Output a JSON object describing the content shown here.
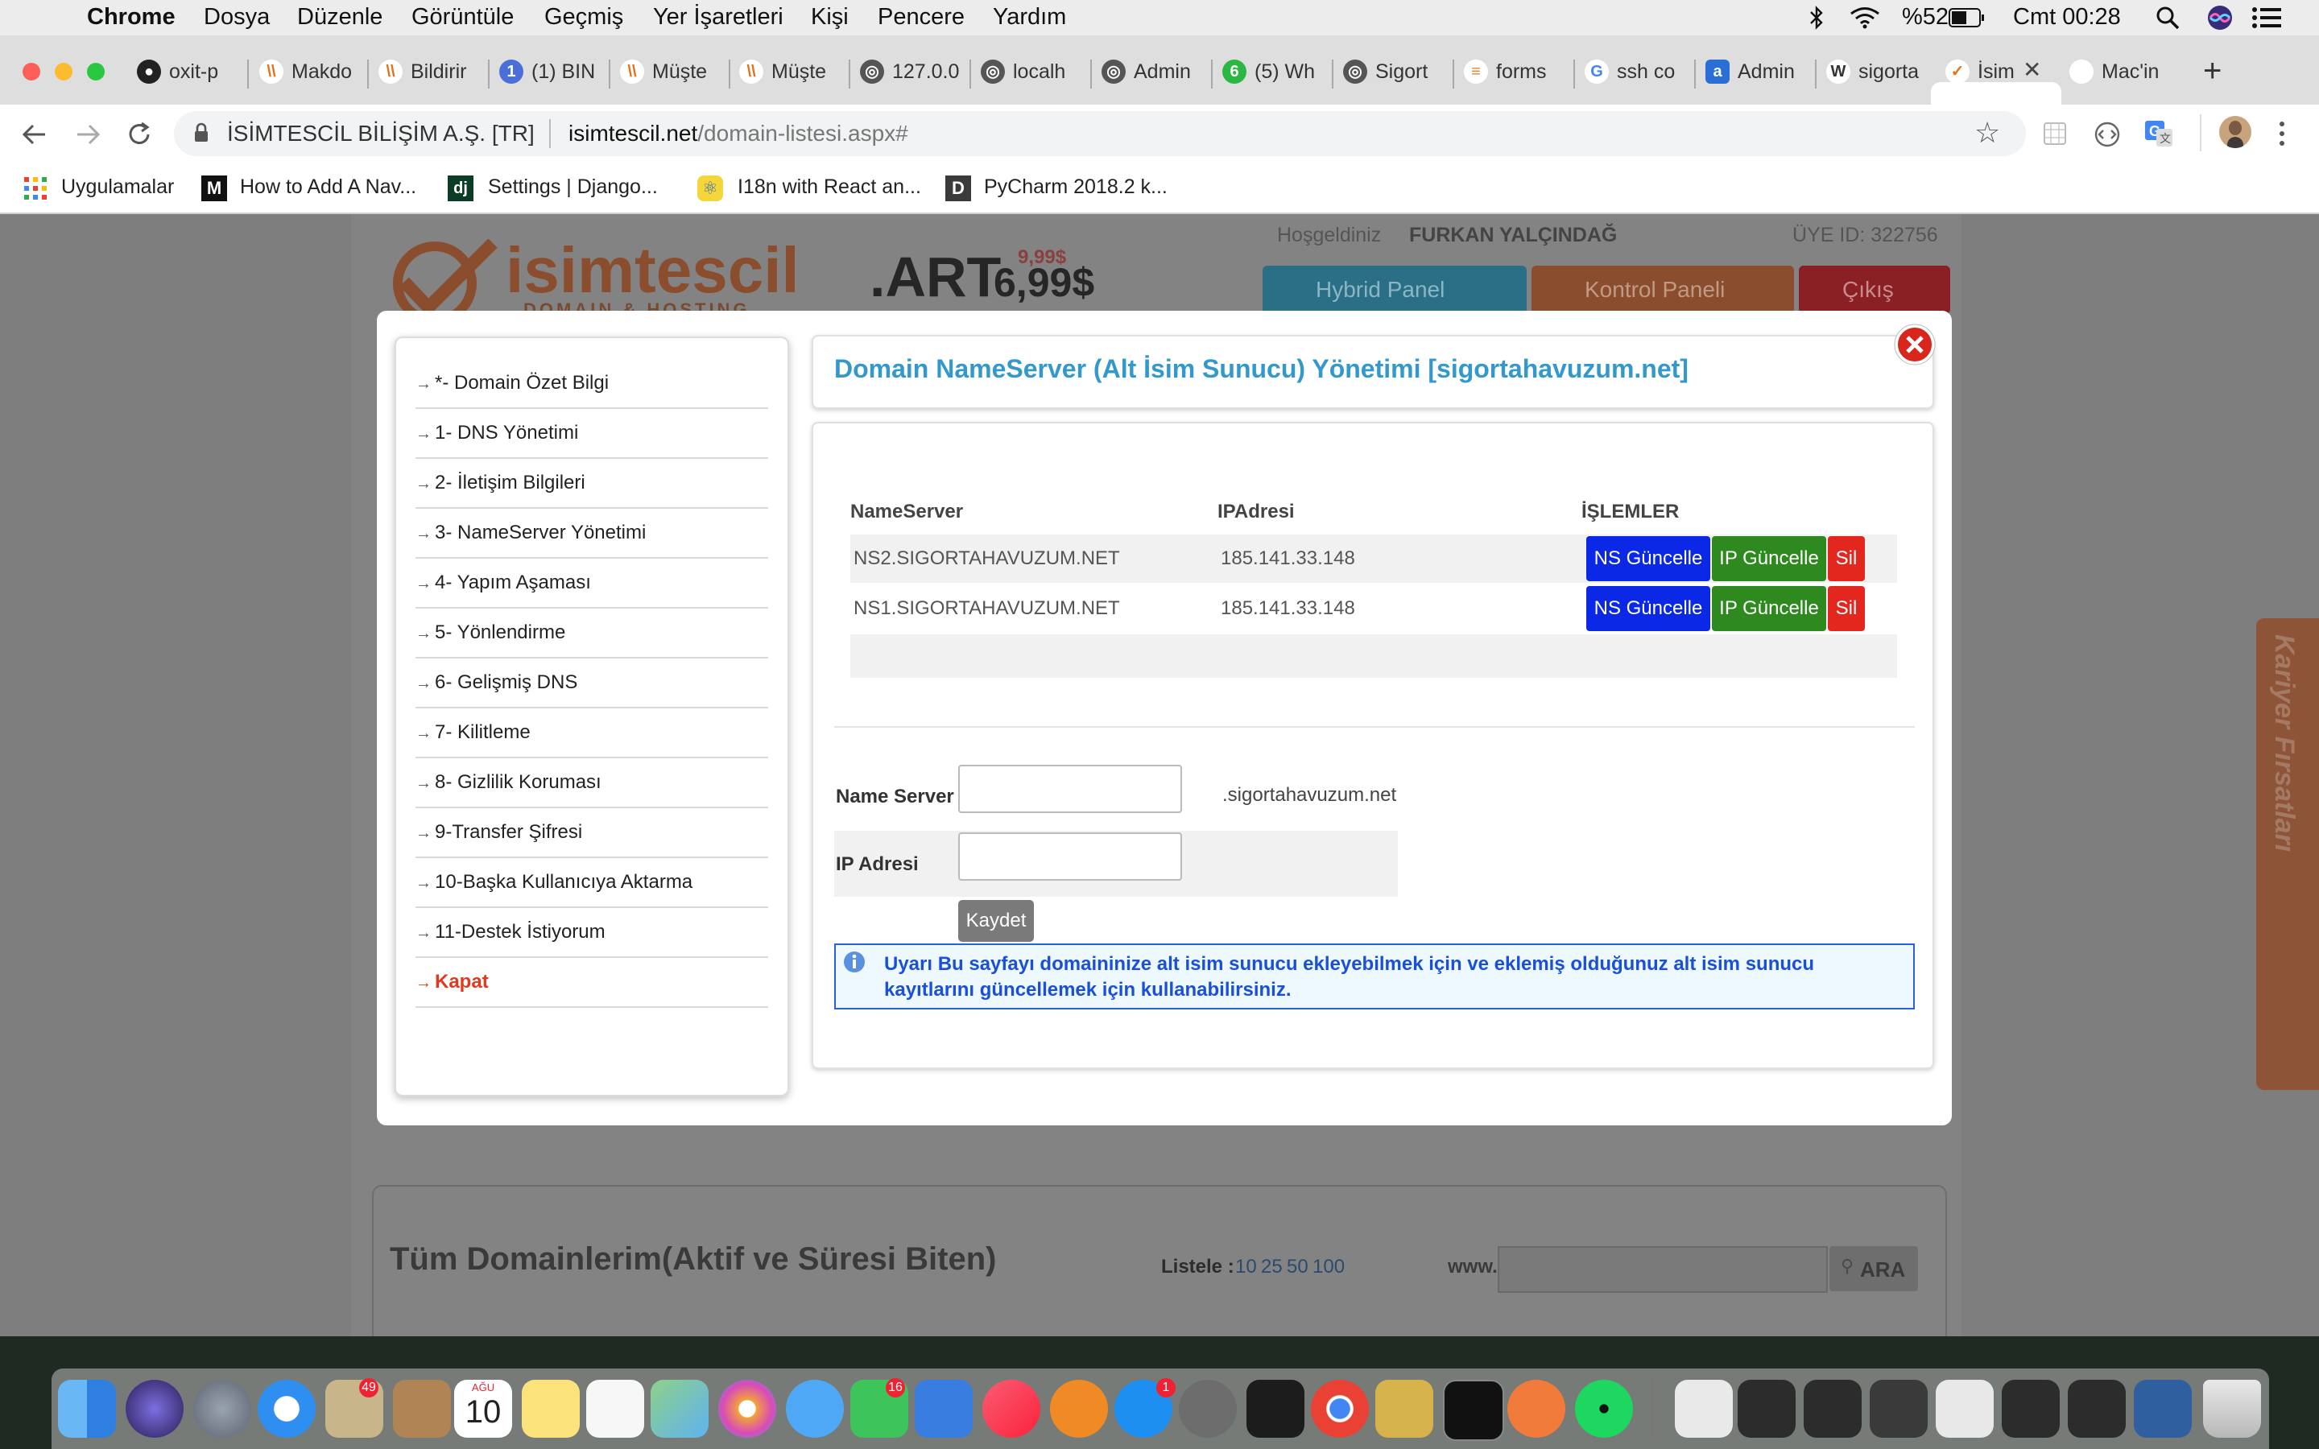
{
  "menubar": {
    "app": "Chrome",
    "items": [
      "Dosya",
      "Düzenle",
      "Görüntüle",
      "Geçmiş",
      "Yer İşaretleri",
      "Kişi",
      "Pencere",
      "Yardım"
    ],
    "battery": "%52",
    "clock": "Cmt 00:28"
  },
  "tabs": [
    {
      "title": "oxit-p",
      "icon": "github-icon"
    },
    {
      "title": "Makdo",
      "icon": "w-logo-icon"
    },
    {
      "title": "Bildirir",
      "icon": "w-logo-icon"
    },
    {
      "title": "(1) BIN",
      "icon": "notification-icon"
    },
    {
      "title": "Müşte",
      "icon": "w-logo-icon"
    },
    {
      "title": "Müşte",
      "icon": "w-logo-icon"
    },
    {
      "title": "127.0.0",
      "icon": "globe-icon"
    },
    {
      "title": "localh",
      "icon": "globe-icon"
    },
    {
      "title": "Admin",
      "icon": "globe-icon"
    },
    {
      "title": "(5) Wh",
      "icon": "whatsapp-icon"
    },
    {
      "title": "Sigort",
      "icon": "globe-icon"
    },
    {
      "title": "forms",
      "icon": "stackoverflow-icon"
    },
    {
      "title": "ssh co",
      "icon": "google-icon"
    },
    {
      "title": "Admin",
      "icon": "a-logo-icon"
    },
    {
      "title": "sigorta",
      "icon": "wordpress-icon"
    },
    {
      "title": "İsim",
      "icon": "isimtescil-icon",
      "active": true
    },
    {
      "title": "Mac'in",
      "icon": "apple-icon"
    }
  ],
  "address": {
    "site_owner": "İSİMTESCİL BİLİŞİM A.Ş. [TR]",
    "host": "isimtescil.net",
    "path": "/domain-listesi.aspx#"
  },
  "bookmarks": [
    {
      "label": "Uygulamalar",
      "icon": "apps-grid-icon"
    },
    {
      "label": "How to Add A Nav...",
      "icon": "medium-icon"
    },
    {
      "label": "Settings | Django...",
      "icon": "django-icon"
    },
    {
      "label": "I18n with React an...",
      "icon": "react-icon"
    },
    {
      "label": "PyCharm 2018.2 k...",
      "icon": "d-logo-icon"
    }
  ],
  "site": {
    "logo": "isimtescil",
    "logo_sub": "DOMAIN & HOSTING",
    "promo": {
      "tld": ".ART",
      "price": "6,99$",
      "old_price": "9,99$"
    },
    "welcome": "Hoşgeldiniz",
    "user": "FURKAN YALÇINDAĞ",
    "member_id": "ÜYE ID: 322756",
    "nav": [
      "Hybrid Panel",
      "Kontrol Paneli",
      "Çıkış"
    ],
    "career_tab": "Kariyer Fırsatları",
    "domains_heading": "Tüm Domainlerim(Aktif ve Süresi Biten)",
    "list_label": "Listele :",
    "list_options": [
      "10",
      "25",
      "50",
      "100"
    ],
    "search_prefix": "www.",
    "search_button": "ARA"
  },
  "modal": {
    "menu": [
      "*- Domain Özet Bilgi",
      "1- DNS Yönetimi",
      "2- İletişim Bilgileri",
      "3- NameServer Yönetimi",
      "4- Yapım Aşaması",
      "5- Yönlendirme",
      "6- Gelişmiş DNS",
      "7- Kilitleme",
      "8- Gizlilik Koruması",
      "9-Transfer Şifresi",
      "10-Başka Kullanıcıya Aktarma",
      "11-Destek İstiyorum",
      "Kapat"
    ],
    "title": "Domain NameServer (Alt İsim Sunucu) Yönetimi [sigortahavuzum.net]",
    "columns": [
      "NameServer",
      "IPAdresi",
      "İŞLEMLER"
    ],
    "rows": [
      {
        "ns": "NS2.SIGORTAHAVUZUM.NET",
        "ip": "185.141.33.148"
      },
      {
        "ns": "NS1.SIGORTAHAVUZUM.NET",
        "ip": "185.141.33.148"
      }
    ],
    "actions": {
      "ns_update": "NS Güncelle",
      "ip_update": "IP Güncelle",
      "delete": "Sil"
    },
    "form": {
      "ns_label": "Name Server",
      "ns_value": "",
      "ns_suffix": ".sigortahavuzum.net",
      "ip_label": "IP Adresi",
      "ip_value": "",
      "save": "Kaydet"
    },
    "warning": "Uyarı Bu sayfayı domaininize alt isim sunucu ekleyebilmek için ve eklemiş olduğunuz alt isim sunucu kayıtlarını güncellemek için kullanabilirsiniz."
  },
  "dock": {
    "calendar": {
      "month": "AĞU",
      "day": "10"
    },
    "badges": {
      "mail": "49",
      "facetime": "16",
      "appstore": "1"
    }
  }
}
